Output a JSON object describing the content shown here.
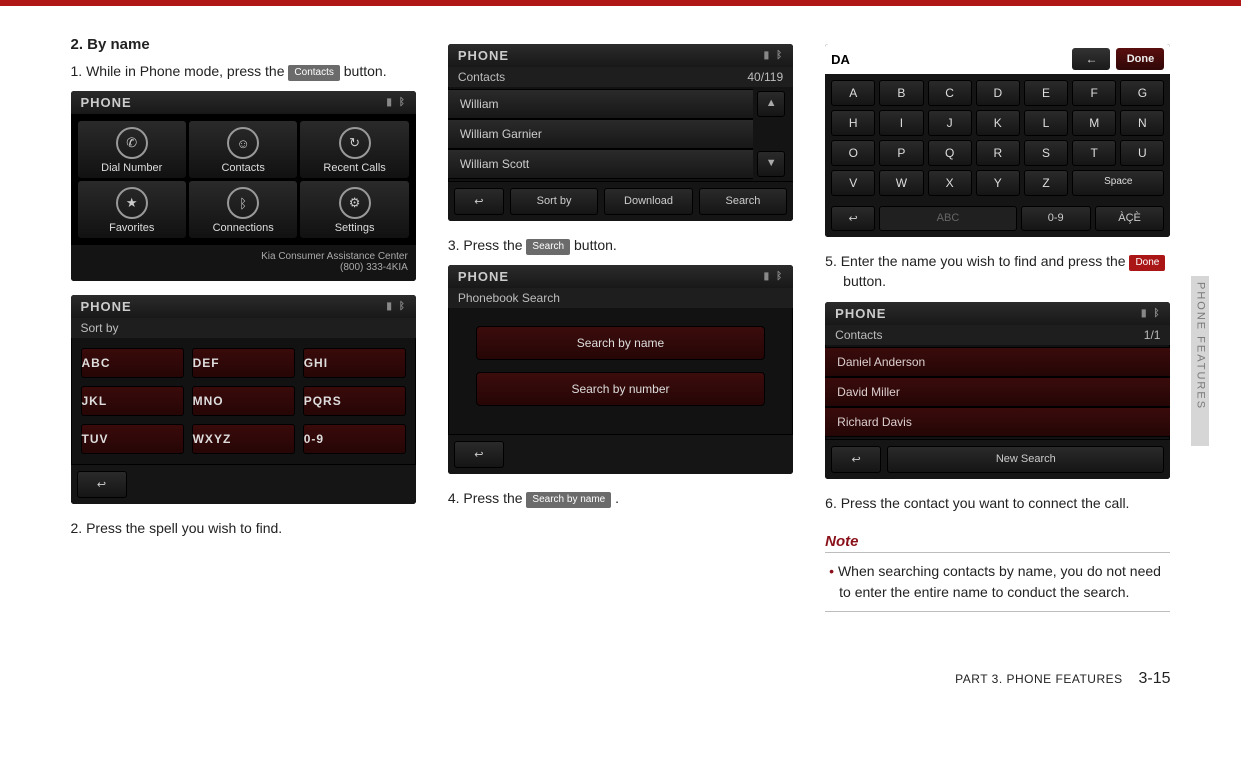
{
  "header": {
    "section_title": "2. By name"
  },
  "steps": {
    "s1a": "1. While in Phone mode, press the ",
    "s1_btn": "Contacts",
    "s1b": " button.",
    "s2": "2. Press the spell you wish to find.",
    "s3a": "3. Press the ",
    "s3_btn": "Search",
    "s3b": " button.",
    "s4a": "4. Press the ",
    "s4_btn": "Search by name",
    "s4b": " .",
    "s5a": "5. Enter the name you wish to find and press the ",
    "s5_btn": "Done",
    "s5b": " button.",
    "s6": "6. Press the contact you want to connect the call."
  },
  "note": {
    "title": "Note",
    "body": "When searching contacts by name, you do not need to enter the entire name to conduct the search."
  },
  "sidetab": "PHONE FEATURES",
  "footer": {
    "part": "PART 3. PHONE FEATURES",
    "page": "3-15"
  },
  "phone_menu": {
    "title": "PHONE",
    "items": [
      "Dial Number",
      "Contacts",
      "Recent Calls",
      "Favorites",
      "Connections",
      "Settings"
    ],
    "assist_line1": "Kia Consumer Assistance Center",
    "assist_line2": "(800) 333-4KIA"
  },
  "sortby": {
    "title": "PHONE",
    "subtitle": "Sort by",
    "keys": [
      "ABC",
      "DEF",
      "GHI",
      "JKL",
      "MNO",
      "PQRS",
      "TUV",
      "WXYZ",
      "0-9"
    ]
  },
  "contacts_list": {
    "title": "PHONE",
    "subtitle": "Contacts",
    "counter": "40/119",
    "rows": [
      "William",
      "William Garnier",
      "William Scott"
    ],
    "bottom": [
      "Sort by",
      "Download",
      "Search"
    ]
  },
  "pb_search": {
    "title": "PHONE",
    "subtitle": "Phonebook Search",
    "opts": [
      "Search by name",
      "Search by number"
    ]
  },
  "keyboard": {
    "input": "DA",
    "done": "Done",
    "keys_rows": [
      [
        "A",
        "B",
        "C",
        "D",
        "E",
        "F",
        "G"
      ],
      [
        "H",
        "I",
        "J",
        "K",
        "L",
        "M",
        "N"
      ],
      [
        "O",
        "P",
        "Q",
        "R",
        "S",
        "T",
        "U"
      ],
      [
        "V",
        "W",
        "X",
        "Y",
        "Z",
        "Space"
      ]
    ],
    "bottom": [
      "ABC",
      "0-9",
      "ÀÇÈ"
    ]
  },
  "results": {
    "title": "PHONE",
    "subtitle": "Contacts",
    "counter": "1/1",
    "rows": [
      "Daniel Anderson",
      "David Miller",
      "Richard Davis"
    ],
    "bottom": [
      "New Search"
    ]
  }
}
